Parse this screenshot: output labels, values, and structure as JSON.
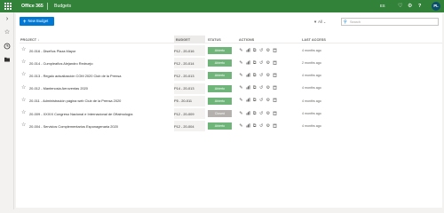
{
  "header": {
    "suite_name": "Office 365",
    "app_name": "Budgets",
    "language": "ES",
    "icons": [
      "waffle-icon",
      "bell-icon",
      "gear-icon",
      "help-icon"
    ],
    "user_initials": "PL"
  },
  "leftrail": {
    "icons": [
      "chevron-right-icon",
      "star-icon",
      "clock-icon",
      "folder-icon"
    ]
  },
  "toolbar": {
    "new_budget_label": "New Budget",
    "filter_label": "All",
    "search_placeholder": "Search"
  },
  "table": {
    "columns": {
      "project": "PROJECT",
      "budget": "BUDGET",
      "status": "STATUS",
      "actions": "ACTIONS",
      "last_access": "LAST ACCESS"
    },
    "action_icons": [
      "edit-icon",
      "chart-icon",
      "copy-icon",
      "history-icon",
      "settings-icon",
      "delete-icon"
    ],
    "rows": [
      {
        "project": "20-016 - Diseños Plaza Mayor",
        "budget": "P12 - 20-016",
        "status": "Abierto",
        "status_type": "open",
        "last_access": "4 months ago"
      },
      {
        "project": "20-014 - Cumpleaños Alejandro Redruejo",
        "budget": "P12 - 20-014",
        "status": "Abierto",
        "status_type": "open",
        "last_access": "2 months ago"
      },
      {
        "project": "20-013 - Regalo actualización COM 2020 Club de la Prensa",
        "budget": "P12 - 20-013",
        "status": "Abierto",
        "status_type": "open",
        "last_access": "4 months ago"
      },
      {
        "project": "20-012 - Mantenosia Aeroventas 2020",
        "budget": "P14 - 20-013",
        "status": "Abierto",
        "status_type": "open",
        "last_access": "4 months ago"
      },
      {
        "project": "20-011 - Administración página web Club de la Prensa 2020",
        "budget": "P5 - 20-011",
        "status": "Abierto",
        "status_type": "open",
        "last_access": "4 months ago"
      },
      {
        "project": "20-009 - XXXIX Congreso Nacional e Internacional de Oftalmología",
        "budget": "P12 - 20-009",
        "status": "Closed",
        "status_type": "closed",
        "last_access": "4 months ago"
      },
      {
        "project": "20-004 - Servicios Complementarios Esponagenaria 2020",
        "budget": "P12 - 20-004",
        "status": "Abierto",
        "status_type": "open",
        "last_access": "4 months ago"
      }
    ]
  }
}
